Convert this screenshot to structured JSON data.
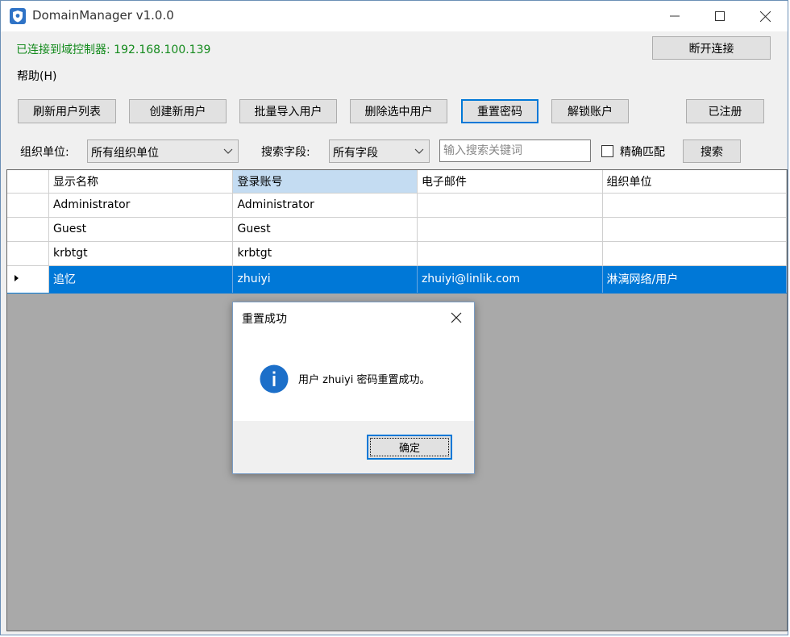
{
  "window": {
    "title": "DomainManager v1.0.0",
    "minimize_glyph": "—",
    "maximize_glyph": "☐",
    "close_glyph": "✕"
  },
  "status": {
    "connection_text": "已连接到域控制器: 192.168.100.139",
    "disconnect_label": "断开连接",
    "color": "#138a1c"
  },
  "menu": {
    "help_label": "帮助(H)"
  },
  "toolbar": {
    "refresh_label": "刷新用户列表",
    "create_label": "创建新用户",
    "import_label": "批量导入用户",
    "delete_label": "删除选中用户",
    "reset_password_label": "重置密码",
    "unlock_label": "解锁账户",
    "registered_label": "已注册"
  },
  "filters": {
    "ou_label": "组织单位:",
    "ou_value": "所有组织单位",
    "field_label": "搜索字段:",
    "field_value": "所有字段",
    "search_placeholder": "输入搜索关键词",
    "exact_match_label": "精确匹配",
    "exact_match_checked": false,
    "search_button_label": "搜索"
  },
  "grid": {
    "columns": [
      "显示名称",
      "登录账号",
      "电子邮件",
      "组织单位"
    ],
    "rows": [
      {
        "display_name": "Administrator",
        "login": "Administrator",
        "email": "",
        "ou": ""
      },
      {
        "display_name": "Guest",
        "login": "Guest",
        "email": "",
        "ou": ""
      },
      {
        "display_name": "krbtgt",
        "login": "krbtgt",
        "email": "",
        "ou": ""
      },
      {
        "display_name": "追忆",
        "login": "zhuiyi",
        "email": "zhuiyi@linlik.com",
        "ou": "淋漓网络/用户",
        "selected": true
      }
    ],
    "selection_color": "#0078d7",
    "sorted_header_color": "#c4dcf2"
  },
  "dialog": {
    "title": "重置成功",
    "message": "用户 zhuiyi 密码重置成功。",
    "ok_label": "确定",
    "icon": "info-icon",
    "icon_color": "#1c6fc9"
  }
}
